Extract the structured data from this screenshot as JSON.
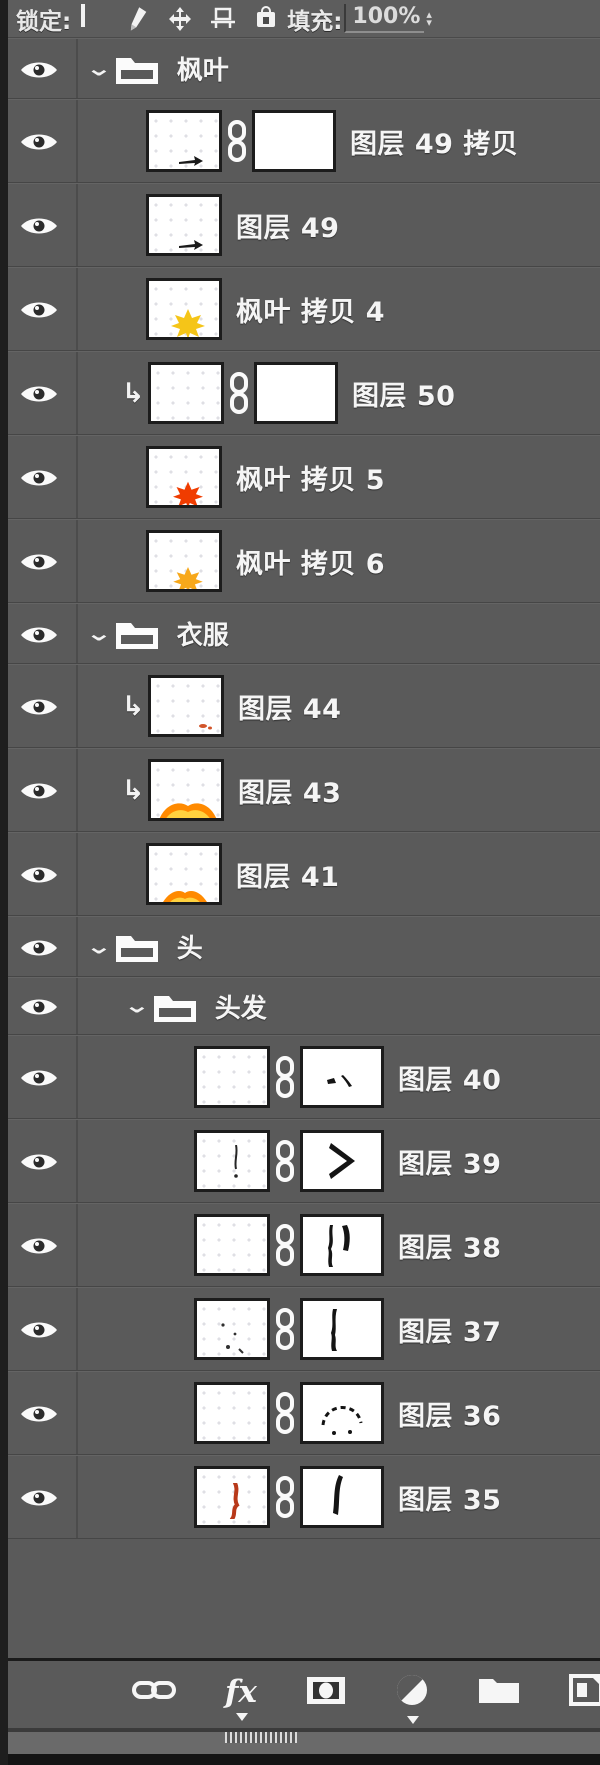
{
  "options_bar": {
    "lock_label": "锁定:",
    "lock_buttons": [
      {
        "name": "lock-transparent-pixels",
        "icon": "checkerboard-icon"
      },
      {
        "name": "lock-image-pixels",
        "icon": "brush-icon"
      },
      {
        "name": "lock-position",
        "icon": "move-arrows-icon"
      },
      {
        "name": "lock-artboard-nesting",
        "icon": "artboard-icon"
      },
      {
        "name": "lock-all",
        "icon": "lock-icon"
      }
    ],
    "fill_label": "填充:",
    "fill_value": "100%"
  },
  "layers": [
    {
      "type": "group",
      "depth": 0,
      "name": "枫叶",
      "visible": true,
      "expanded": true
    },
    {
      "type": "layer",
      "depth": 1,
      "name": "图层 49 拷贝",
      "visible": true,
      "has_mask": true,
      "linked": true,
      "clipped": false,
      "art": "arrow-small"
    },
    {
      "type": "layer",
      "depth": 1,
      "name": "图层 49",
      "visible": true,
      "has_mask": false,
      "clipped": false,
      "art": "arrow-small"
    },
    {
      "type": "layer",
      "depth": 1,
      "name": "枫叶 拷贝 4",
      "visible": true,
      "has_mask": false,
      "clipped": false,
      "art": "leaf-yellow"
    },
    {
      "type": "layer",
      "depth": 1,
      "name": "图层 50",
      "visible": true,
      "has_mask": true,
      "linked": true,
      "clipped": true,
      "art": "blank"
    },
    {
      "type": "layer",
      "depth": 1,
      "name": "枫叶 拷贝 5",
      "visible": true,
      "has_mask": false,
      "clipped": false,
      "art": "leaf-red"
    },
    {
      "type": "layer",
      "depth": 1,
      "name": "枫叶 拷贝 6",
      "visible": true,
      "has_mask": false,
      "clipped": false,
      "art": "leaf-orange"
    },
    {
      "type": "group",
      "depth": 0,
      "name": "衣服",
      "visible": true,
      "expanded": true
    },
    {
      "type": "layer",
      "depth": 1,
      "name": "图层 44",
      "visible": true,
      "has_mask": false,
      "clipped": true,
      "art": "speck"
    },
    {
      "type": "layer",
      "depth": 1,
      "name": "图层 43",
      "visible": true,
      "has_mask": false,
      "clipped": true,
      "art": "cloth-orange"
    },
    {
      "type": "layer",
      "depth": 1,
      "name": "图层 41",
      "visible": true,
      "has_mask": false,
      "clipped": false,
      "art": "cloth-orange2"
    },
    {
      "type": "group",
      "depth": 0,
      "name": "头",
      "visible": true,
      "expanded": true
    },
    {
      "type": "group",
      "depth": 1,
      "name": "头发",
      "visible": true,
      "expanded": true
    },
    {
      "type": "layer",
      "depth": 2,
      "name": "图层 40",
      "visible": true,
      "has_mask": true,
      "linked": true,
      "clipped": false,
      "art": "blank",
      "mask": "dots-pair"
    },
    {
      "type": "layer",
      "depth": 2,
      "name": "图层 39",
      "visible": true,
      "has_mask": true,
      "linked": true,
      "clipped": false,
      "art": "stroke-thin",
      "mask": "chevron"
    },
    {
      "type": "layer",
      "depth": 2,
      "name": "图层 38",
      "visible": true,
      "has_mask": true,
      "linked": true,
      "clipped": false,
      "art": "blank",
      "mask": "double-stroke"
    },
    {
      "type": "layer",
      "depth": 2,
      "name": "图层 37",
      "visible": true,
      "has_mask": true,
      "linked": true,
      "clipped": false,
      "art": "specks",
      "mask": "single-stroke"
    },
    {
      "type": "layer",
      "depth": 2,
      "name": "图层 36",
      "visible": true,
      "has_mask": true,
      "linked": true,
      "clipped": false,
      "art": "blank",
      "mask": "arc-dots"
    },
    {
      "type": "layer",
      "depth": 2,
      "name": "图层 35",
      "visible": true,
      "has_mask": true,
      "linked": true,
      "clipped": false,
      "art": "red-speck",
      "mask": "curve"
    }
  ],
  "bottom_bar": {
    "buttons": [
      {
        "name": "link-layers-button",
        "icon": "link-icon",
        "has_caret": false
      },
      {
        "name": "layer-style-button",
        "icon": "fx-icon",
        "has_caret": true
      },
      {
        "name": "add-layer-mask-button",
        "icon": "mask-icon",
        "has_caret": false
      },
      {
        "name": "new-adjustment-layer-button",
        "icon": "half-circle-icon",
        "has_caret": true
      },
      {
        "name": "new-group-button",
        "icon": "folder-icon",
        "has_caret": false
      },
      {
        "name": "new-layer-button",
        "icon": "new-layer-icon",
        "has_caret": false
      },
      {
        "name": "delete-layer-button",
        "icon": "trash-icon",
        "has_caret": false
      }
    ]
  }
}
